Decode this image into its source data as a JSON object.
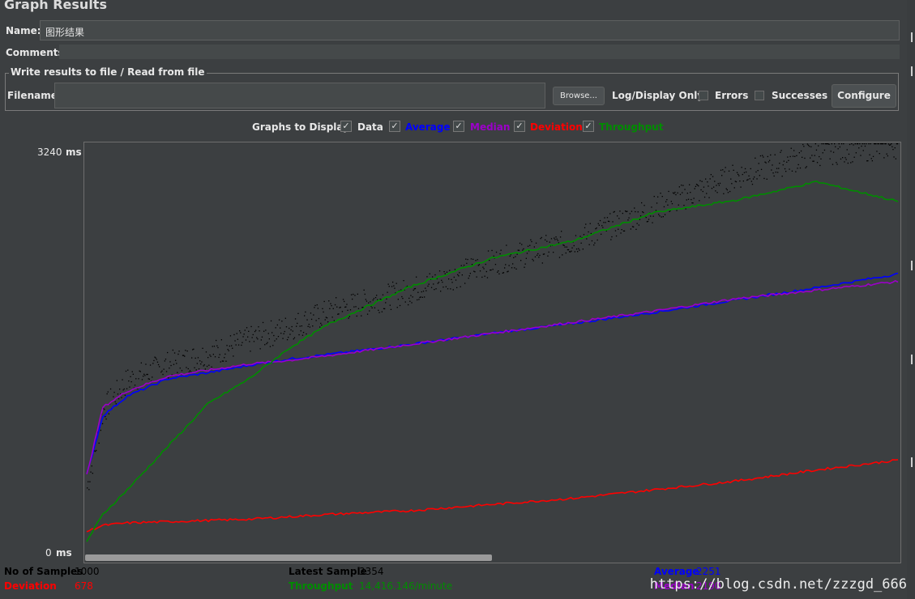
{
  "window": {
    "title": "Graph Results"
  },
  "name_row": {
    "label": "Name:",
    "value": "图形结果"
  },
  "comments_row": {
    "label": "Comments:",
    "value": ""
  },
  "file_section": {
    "legend": "Write results to file / Read from file",
    "filename_label": "Filename",
    "filename_value": "",
    "browse_label": "Browse...",
    "log_display_label": "Log/Display Only:",
    "errors_label": "Errors",
    "errors_checked": false,
    "successes_label": "Successes",
    "successes_checked": false,
    "configure_label": "Configure"
  },
  "graphs_to_display": {
    "label": "Graphs to Display",
    "options": [
      {
        "key": "data",
        "label": "Data",
        "checked": true,
        "color": "#000000"
      },
      {
        "key": "average",
        "label": "Average",
        "checked": true,
        "color": "#0000ff"
      },
      {
        "key": "median",
        "label": "Median",
        "checked": true,
        "color": "#9c00c9"
      },
      {
        "key": "deviation",
        "label": "Deviation",
        "checked": true,
        "color": "#ff0000"
      },
      {
        "key": "throughput",
        "label": "Throughput",
        "checked": true,
        "color": "#008c00"
      }
    ]
  },
  "y_axis": {
    "max_label": "3240",
    "max_unit": "ms",
    "min_label": "0",
    "min_unit": "ms"
  },
  "chart_data": {
    "type": "line",
    "x": [
      0,
      20,
      50,
      100,
      150,
      200,
      250,
      300,
      400,
      500,
      600,
      700,
      800,
      900,
      1000
    ],
    "ylim": [
      0,
      3240
    ],
    "series": [
      {
        "name": "Data",
        "color": "#000000",
        "style": "scatter",
        "values": [
          520,
          1150,
          1390,
          1520,
          1600,
          1720,
          1820,
          1950,
          2120,
          2350,
          2520,
          2790,
          3050,
          3240,
          3300
        ]
      },
      {
        "name": "Average",
        "color": "#0000ff",
        "values": [
          620,
          1100,
          1260,
          1400,
          1450,
          1510,
          1560,
          1600,
          1680,
          1770,
          1850,
          1940,
          2040,
          2140,
          2251
        ]
      },
      {
        "name": "Median",
        "color": "#9c00c9",
        "values": [
          620,
          1170,
          1300,
          1420,
          1470,
          1520,
          1550,
          1590,
          1680,
          1770,
          1860,
          1950,
          2050,
          2120,
          2190
        ]
      },
      {
        "name": "Deviation",
        "color": "#ff0000",
        "values": [
          160,
          210,
          230,
          240,
          250,
          260,
          280,
          300,
          330,
          380,
          430,
          500,
          570,
          660,
          740
        ]
      },
      {
        "name": "Throughput",
        "color": "#008c00",
        "values": [
          80,
          300,
          500,
          850,
          1200,
          1400,
          1650,
          1850,
          2150,
          2380,
          2520,
          2750,
          2850,
          3000,
          2840
        ]
      }
    ]
  },
  "stats": {
    "samples_label": "No of Samples",
    "samples_value": "1000",
    "latest_label": "Latest Sample",
    "latest_value": "3354",
    "average_label": "Average",
    "average_value": "2251",
    "deviation_label": "Deviation",
    "deviation_value": "678",
    "throughput_label": "Throughput",
    "throughput_value": "14,416.146/minute",
    "median_label": "Median",
    "median_value": "2190"
  },
  "watermark": "https://blog.csdn.net/zzzgd_666"
}
